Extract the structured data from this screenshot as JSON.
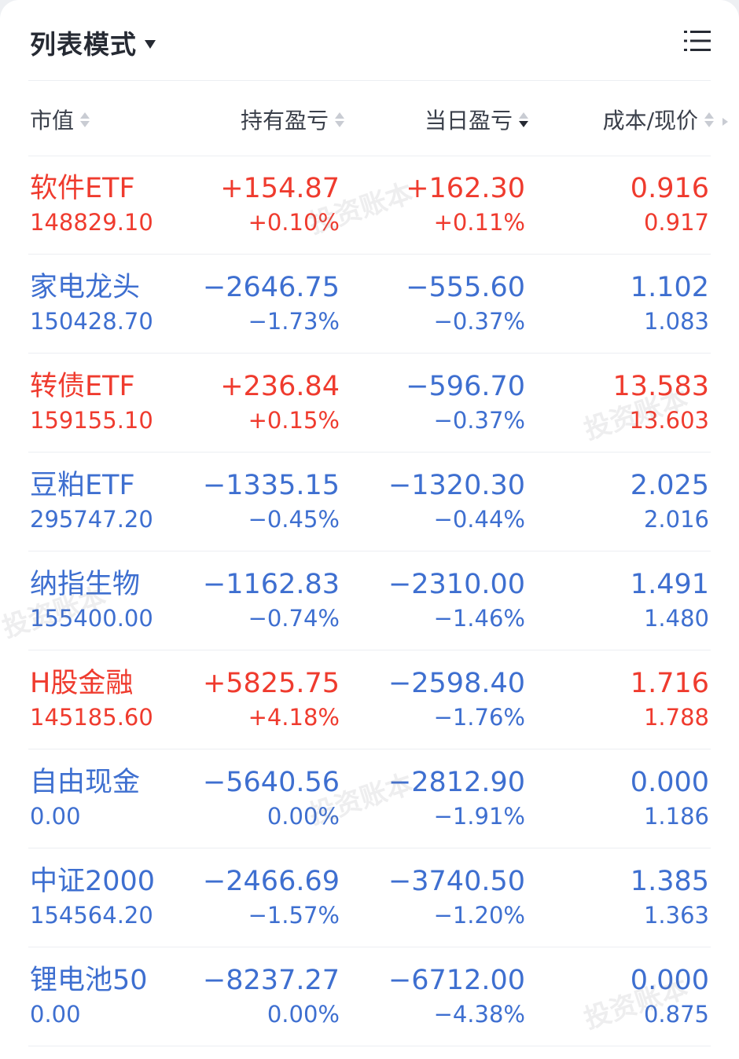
{
  "header": {
    "mode_label": "列表模式"
  },
  "columns": {
    "market_value": "市值",
    "holding_pnl": "持有盈亏",
    "daily_pnl": "当日盈亏",
    "cost_price": "成本/现价"
  },
  "rows": [
    {
      "name": "软件ETF",
      "market_value": "148829.10",
      "holding_pnl": "+154.87",
      "holding_pct": "+0.10%",
      "daily_pnl": "+162.30",
      "daily_pct": "+0.11%",
      "cost": "0.916",
      "price": "0.917",
      "name_color": "red",
      "hold_color": "red",
      "day_color": "red",
      "price_color": "red"
    },
    {
      "name": "家电龙头",
      "market_value": "150428.70",
      "holding_pnl": "−2646.75",
      "holding_pct": "−1.73%",
      "daily_pnl": "−555.60",
      "daily_pct": "−0.37%",
      "cost": "1.102",
      "price": "1.083",
      "name_color": "blue",
      "hold_color": "blue",
      "day_color": "blue",
      "price_color": "blue"
    },
    {
      "name": "转债ETF",
      "market_value": "159155.10",
      "holding_pnl": "+236.84",
      "holding_pct": "+0.15%",
      "daily_pnl": "−596.70",
      "daily_pct": "−0.37%",
      "cost": "13.583",
      "price": "13.603",
      "name_color": "red",
      "hold_color": "red",
      "day_color": "blue",
      "price_color": "red"
    },
    {
      "name": "豆粕ETF",
      "market_value": "295747.20",
      "holding_pnl": "−1335.15",
      "holding_pct": "−0.45%",
      "daily_pnl": "−1320.30",
      "daily_pct": "−0.44%",
      "cost": "2.025",
      "price": "2.016",
      "name_color": "blue",
      "hold_color": "blue",
      "day_color": "blue",
      "price_color": "blue"
    },
    {
      "name": "纳指生物",
      "market_value": "155400.00",
      "holding_pnl": "−1162.83",
      "holding_pct": "−0.74%",
      "daily_pnl": "−2310.00",
      "daily_pct": "−1.46%",
      "cost": "1.491",
      "price": "1.480",
      "name_color": "blue",
      "hold_color": "blue",
      "day_color": "blue",
      "price_color": "blue"
    },
    {
      "name": "H股金融",
      "market_value": "145185.60",
      "holding_pnl": "+5825.75",
      "holding_pct": "+4.18%",
      "daily_pnl": "−2598.40",
      "daily_pct": "−1.76%",
      "cost": "1.716",
      "price": "1.788",
      "name_color": "red",
      "hold_color": "red",
      "day_color": "blue",
      "price_color": "red"
    },
    {
      "name": "自由现金",
      "market_value": "0.00",
      "holding_pnl": "−5640.56",
      "holding_pct": "0.00%",
      "daily_pnl": "−2812.90",
      "daily_pct": "−1.91%",
      "cost": "0.000",
      "price": "1.186",
      "name_color": "blue",
      "hold_color": "blue",
      "day_color": "blue",
      "price_color": "blue"
    },
    {
      "name": "中证2000",
      "market_value": "154564.20",
      "holding_pnl": "−2466.69",
      "holding_pct": "−1.57%",
      "daily_pnl": "−3740.50",
      "daily_pct": "−1.20%",
      "cost": "1.385",
      "price": "1.363",
      "name_color": "blue",
      "hold_color": "blue",
      "day_color": "blue",
      "price_color": "blue"
    },
    {
      "name": "锂电池50",
      "market_value": "0.00",
      "holding_pnl": "−8237.27",
      "holding_pct": "0.00%",
      "daily_pnl": "−6712.00",
      "daily_pct": "−4.38%",
      "cost": "0.000",
      "price": "0.875",
      "name_color": "blue",
      "hold_color": "blue",
      "day_color": "blue",
      "price_color": "blue"
    }
  ],
  "watermark": "投资账本",
  "colors": {
    "gain": "#ef3b2e",
    "loss": "#3e6fd0",
    "text": "#262a33"
  }
}
